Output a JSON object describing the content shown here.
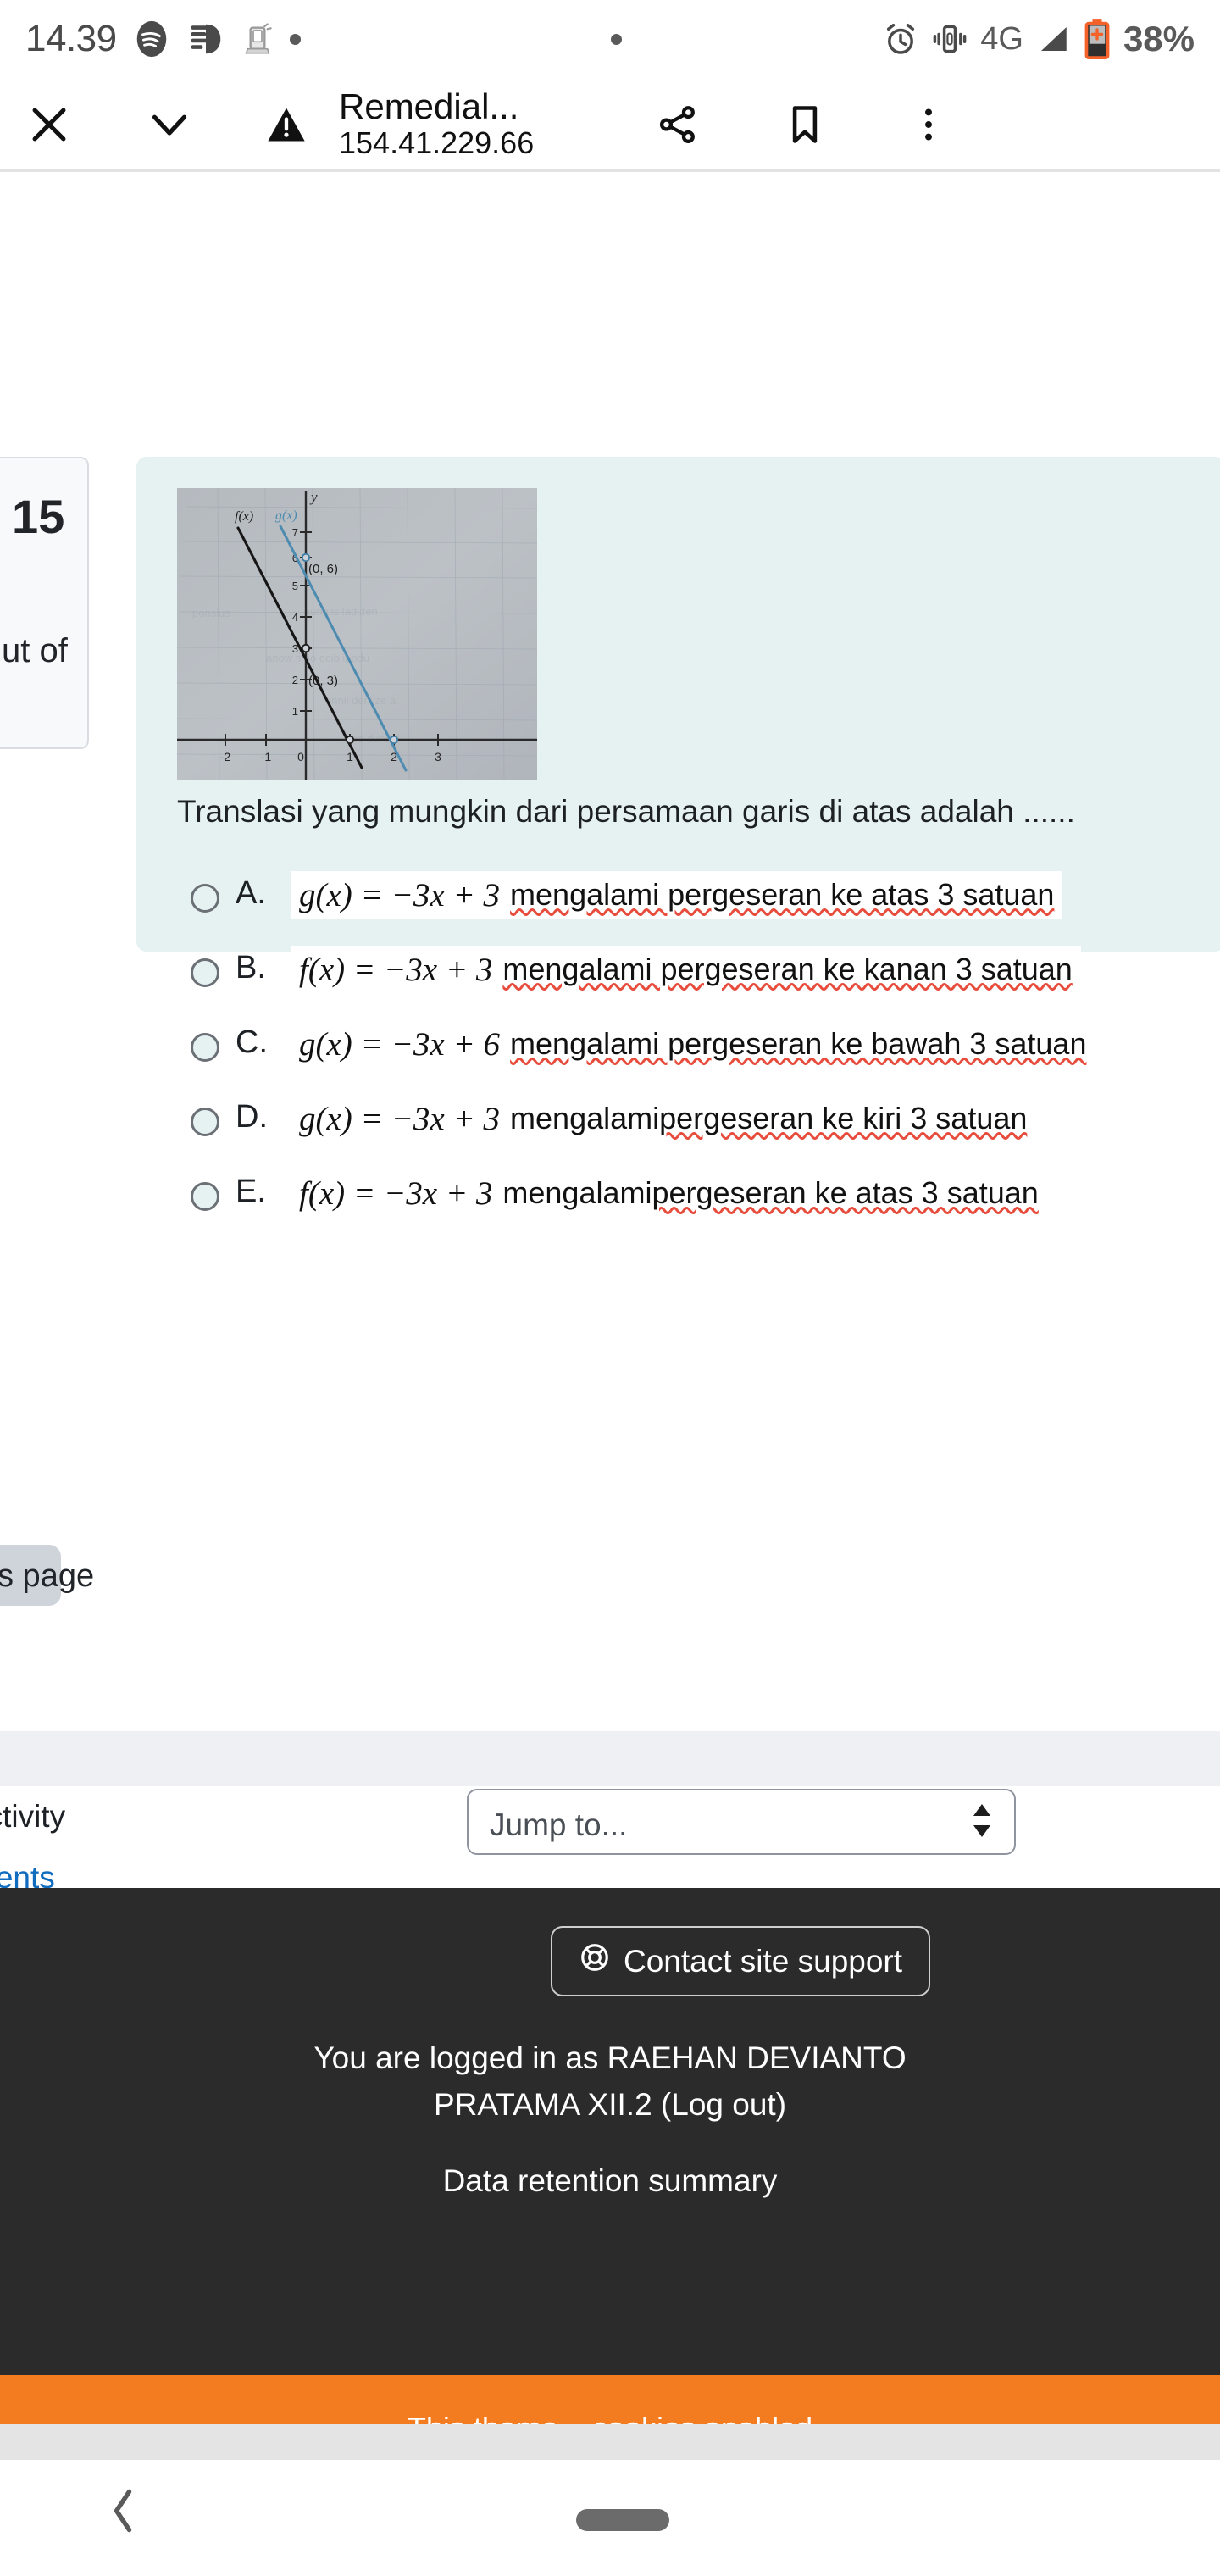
{
  "status_bar": {
    "time": "14.39",
    "left_icons": [
      "spotify-icon",
      "download-icon",
      "device-icon",
      "dot-icon"
    ],
    "right_icons": [
      "dot-icon",
      "alarm-icon",
      "vibrate-icon",
      "signal-icon",
      "battery-icon"
    ],
    "network": "4G",
    "battery": "38%"
  },
  "toolbar": {
    "close_label": "✕",
    "collapse_label": "∨",
    "security_icon": "warning-triangle-icon",
    "title": "Remedial...",
    "url": "154.41.229.66",
    "share_icon": "share-icon",
    "bookmark_icon": "bookmark-icon",
    "menu_icon": "more-vertical-icon"
  },
  "info_card": {
    "question_number": "15",
    "marked_out_of": "ut of"
  },
  "question": {
    "prompt": "Translasi yang mungkin dari persamaan garis di atas adalah ......",
    "image_alt": "graph-photo",
    "options": [
      {
        "letter": "A.",
        "formula": "g(x) = −3x + 3",
        "text": "mengalami pergeseran ke atas 3 satuan",
        "spellcheck_all": true,
        "selected": false
      },
      {
        "letter": "B.",
        "formula": "f(x) = −3x + 3",
        "text": "mengalami pergeseran ke kanan 3 satuan",
        "spellcheck_all": true,
        "selected": false
      },
      {
        "letter": "C.",
        "formula": "g(x) = −3x + 6",
        "text": "mengalami pergeseran ke bawah 3 satuan",
        "spellcheck_all": true,
        "selected": false
      },
      {
        "letter": "D.",
        "formula": "g(x) = −3x + 3",
        "text_plain": "mengalami ",
        "text": "pergeseran ke kiri 3 satuan",
        "spellcheck_all": false,
        "selected": false
      },
      {
        "letter": "E.",
        "formula": "f(x) = −3x + 3",
        "text_plain": "mengalami ",
        "text": "pergeseran ke atas 3 satuan",
        "spellcheck_all": false,
        "selected": false
      }
    ]
  },
  "chart_data": {
    "type": "line",
    "title": "",
    "xlabel": "",
    "ylabel": "y",
    "xlim": [
      -2.6,
      3.6
    ],
    "ylim": [
      -0.7,
      7.6
    ],
    "xticks": [
      "-2",
      "-1",
      "0",
      "1",
      "2",
      "3"
    ],
    "yticks": [
      "1",
      "2",
      "3",
      "4",
      "5",
      "6",
      "7"
    ],
    "grid": true,
    "series": [
      {
        "name": "f(x)",
        "color": "#1a1a1a",
        "equation": "f(x) = -3x + 3",
        "points": [
          [
            -0.45,
            4.35
          ],
          [
            1.3,
            -0.9
          ]
        ],
        "markers": [
          [
            0,
            3
          ],
          [
            1,
            0
          ]
        ],
        "labels": [
          "(0, 3)"
        ]
      },
      {
        "name": "g(x)",
        "color": "#4a87ae",
        "equation": "g(x) = -3x + 6",
        "points": [
          [
            -0.45,
            7.35
          ],
          [
            2.3,
            -0.9
          ]
        ],
        "markers": [
          [
            0,
            6
          ],
          [
            2,
            0
          ]
        ],
        "labels": [
          "(0, 6)"
        ]
      }
    ],
    "annotations": [
      "(0, 6)",
      "(0, 3)",
      "f(x)",
      "g(x)",
      "y"
    ]
  },
  "navigation": {
    "previous_page": "s page",
    "previous_activity": " activity",
    "activity_link": "ments",
    "jump_to_placeholder": "Jump to..."
  },
  "footer": {
    "support_icon": "life-ring-icon",
    "support_label": "Contact site support",
    "logged_in_line1": "You are logged in as RAEHAN DEVIANTO",
    "logged_in_line2": "PRATAMA XII.2 (Log out)",
    "data_retention": "Data retention summary",
    "banner_text": "This theme... cookies enabled",
    "banner_color": "#f47c20"
  },
  "bottom_nav": {
    "back_icon": "chevron-left-icon",
    "home_icon": "home-pill-icon"
  }
}
